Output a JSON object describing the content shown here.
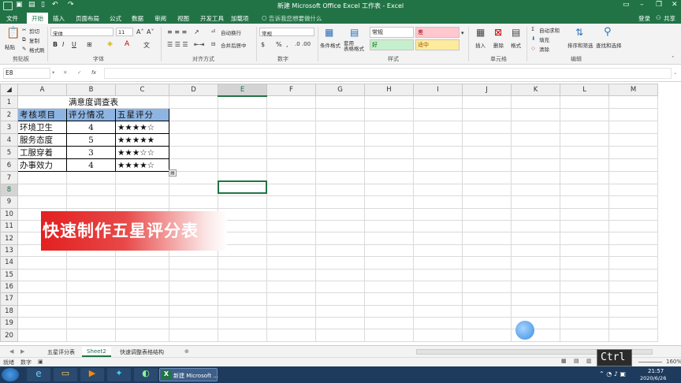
{
  "window": {
    "title": "新建 Microsoft Office Excel 工作表 - Excel"
  },
  "tabs": [
    "文件",
    "开始",
    "插入",
    "页面布局",
    "公式",
    "数据",
    "审阅",
    "视图",
    "开发工具",
    "加载项"
  ],
  "active_tab": "开始",
  "tell_me": "告诉我您想要做什么",
  "account": {
    "login": "登录",
    "share": "共享"
  },
  "ribbon": {
    "clipboard": {
      "group": "剪贴板",
      "paste": "粘贴",
      "cut": "剪切",
      "copy": "复制",
      "format_painter": "格式刷"
    },
    "font": {
      "group": "字体",
      "name": "宋体",
      "size": "11",
      "bold": "B",
      "italic": "I",
      "underline": "U"
    },
    "align": {
      "group": "对齐方式",
      "wrap": "自动换行",
      "merge": "合并后居中"
    },
    "number": {
      "group": "数字",
      "format": "常规",
      "percent": "%",
      "comma": ","
    },
    "styles": {
      "group": "样式",
      "cond": "条件格式",
      "table": "套用\n表格格式",
      "normal": "常规",
      "bad": "差",
      "good": "好",
      "neutral": "适中"
    },
    "cells": {
      "group": "单元格",
      "insert": "插入",
      "delete": "删除",
      "format": "格式"
    },
    "editing": {
      "group": "编辑",
      "autosum": "自动求和",
      "fill": "填充",
      "clear": "清除",
      "sort": "排序和筛选",
      "find": "查找和选择"
    }
  },
  "formula_bar": {
    "name_box": "E8",
    "fx": "fx",
    "value": ""
  },
  "columns": [
    "A",
    "B",
    "C",
    "D",
    "E",
    "F",
    "G",
    "H",
    "I",
    "J",
    "K",
    "L",
    "M"
  ],
  "rows": [
    "1",
    "2",
    "3",
    "4",
    "5",
    "6",
    "7",
    "8",
    "9",
    "10",
    "11",
    "12",
    "13",
    "14",
    "15",
    "16",
    "17",
    "18",
    "19",
    "20"
  ],
  "sheet": {
    "title": "满意度调查表",
    "headers": [
      "考核项目",
      "评分情况",
      "五星评分"
    ],
    "data": [
      {
        "item": "环境卫生",
        "score": "4",
        "stars": "★★★★☆"
      },
      {
        "item": "服务态度",
        "score": "5",
        "stars": "★★★★★"
      },
      {
        "item": "工服穿着",
        "score": "3",
        "stars": "★★★☆☆"
      },
      {
        "item": "办事效力",
        "score": "4",
        "stars": "★★★★☆"
      }
    ]
  },
  "banner": "快速制作五星评分表",
  "sheet_tabs": [
    "五星评分表",
    "Sheet2",
    "快速调整表格结构"
  ],
  "active_sheet": "Sheet2",
  "status": {
    "mode": "就绪",
    "num": "数字",
    "zoom": "160%"
  },
  "taskbar": {
    "excel_label": "新建 Microsoft ...",
    "time": "21:57",
    "date": "2020/6/26"
  },
  "key_overlay": "Ctrl"
}
